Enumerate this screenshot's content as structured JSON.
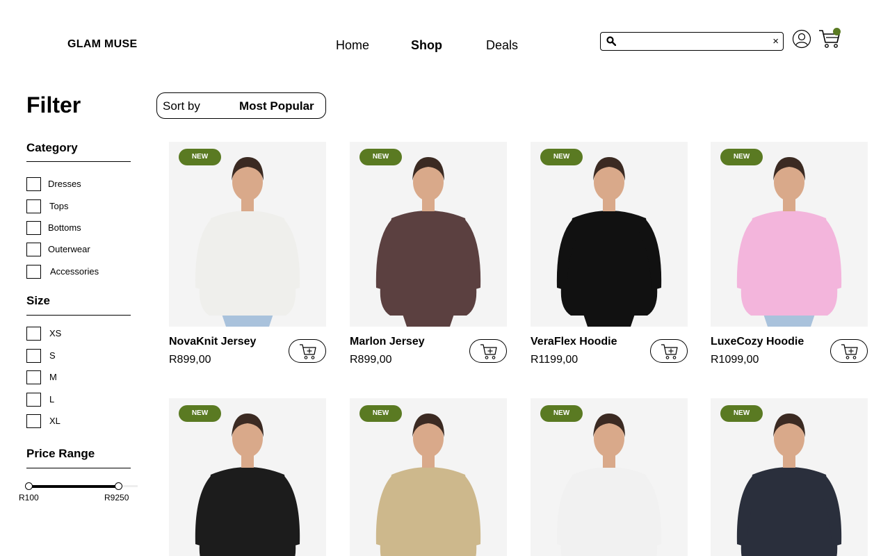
{
  "header": {
    "logo": "GLAM MUSE",
    "nav": [
      {
        "label": "Home",
        "active": false
      },
      {
        "label": "Shop",
        "active": true
      },
      {
        "label": "Deals",
        "active": false
      }
    ],
    "search": {
      "value": "",
      "placeholder": "",
      "clear_glyph": "×"
    },
    "cart_badge_color": "#5a7a22"
  },
  "filter": {
    "title": "Filter",
    "category": {
      "title": "Category",
      "items": [
        "Dresses",
        "Tops",
        "Bottoms",
        "Outerwear",
        "Accessories"
      ]
    },
    "size": {
      "title": "Size",
      "items": [
        "XS",
        "S",
        "M",
        "L",
        "XL"
      ]
    },
    "price_range": {
      "title": "Price Range",
      "min_label": "R100",
      "max_label": "R9250"
    }
  },
  "sort": {
    "label": "Sort by",
    "value": "Most Popular"
  },
  "products": [
    {
      "badge": "NEW",
      "name": "NovaKnit Jersey",
      "price": "R899,00",
      "garment_color": "#efefec",
      "pants_color": "#a9c2dc"
    },
    {
      "badge": "NEW",
      "name": "Marlon Jersey",
      "price": "R899,00",
      "garment_color": "#5b4040",
      "pants_color": "#5b4040"
    },
    {
      "badge": "NEW",
      "name": "VeraFlex Hoodie",
      "price": "R1199,00",
      "garment_color": "#111111",
      "pants_color": "#111111"
    },
    {
      "badge": "NEW",
      "name": "LuxeCozy Hoodie",
      "price": "R1099,00",
      "garment_color": "#f3b5dc",
      "pants_color": "#a9c2dc"
    },
    {
      "badge": "NEW",
      "name": "",
      "price": "",
      "garment_color": "#1c1c1c",
      "pants_color": "#e9cf9c"
    },
    {
      "badge": "NEW",
      "name": "",
      "price": "",
      "garment_color": "#cdb88c",
      "pants_color": "#cdb88c"
    },
    {
      "badge": "NEW",
      "name": "",
      "price": "",
      "garment_color": "#f1f1f1",
      "pants_color": "#f1f1f1"
    },
    {
      "badge": "NEW",
      "name": "",
      "price": "",
      "garment_color": "#2a2f3c",
      "pants_color": "#22252c"
    }
  ],
  "accent_color": "#5a7a22"
}
